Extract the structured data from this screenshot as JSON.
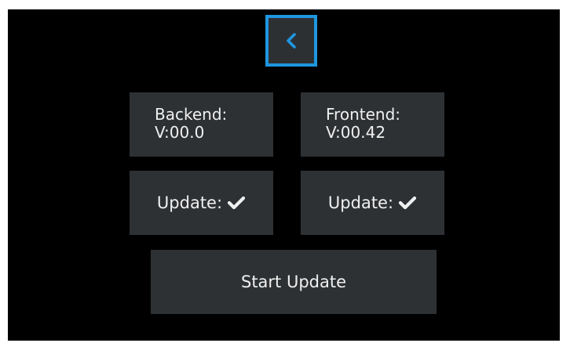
{
  "nav": {
    "back_icon": "chevron-left-icon",
    "accent_color": "#1e96e0"
  },
  "backend": {
    "title": "Backend:",
    "version": "V:00.0",
    "update_label": "Update:",
    "update_status_icon": "checkmark-icon"
  },
  "frontend": {
    "title": "Frontend:",
    "version": "V:00.42",
    "update_label": "Update:",
    "update_status_icon": "checkmark-icon"
  },
  "actions": {
    "start_update_label": "Start Update"
  },
  "colors": {
    "background": "#000000",
    "tile": "#2e3134",
    "text": "#f0f0f0"
  }
}
